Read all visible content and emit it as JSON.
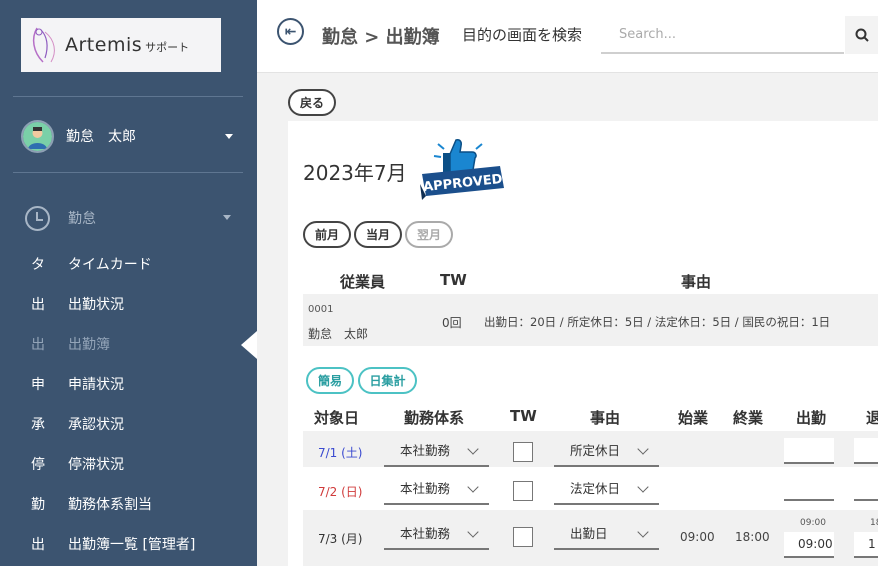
{
  "logo": {
    "name": "Artemis",
    "sub": "サポート"
  },
  "user": {
    "name": "勤怠　太郎"
  },
  "sidebar": {
    "section": "勤怠",
    "items": [
      {
        "abbr": "タ",
        "label": "タイムカード"
      },
      {
        "abbr": "出",
        "label": "出勤状況"
      },
      {
        "abbr": "出",
        "label": "出勤簿"
      },
      {
        "abbr": "申",
        "label": "申請状況"
      },
      {
        "abbr": "承",
        "label": "承認状況"
      },
      {
        "abbr": "停",
        "label": "停滞状況"
      },
      {
        "abbr": "勤",
        "label": "勤務体系割当"
      },
      {
        "abbr": "出",
        "label": "出勤簿一覧 [管理者]"
      }
    ]
  },
  "header": {
    "breadcrumb": "勤怠 > 出勤簿",
    "search_label": "目的の画面を検索",
    "search_placeholder": "Search..."
  },
  "back_button": "戻る",
  "card": {
    "month": "2023年7月",
    "badge_text": "APPROVED",
    "month_nav": {
      "prev": "前月",
      "current": "当月",
      "next": "翌月"
    },
    "summary": {
      "headers": {
        "employee": "従業員",
        "tw": "TW",
        "reason": "事由"
      },
      "row": {
        "id": "0001",
        "name": "勤怠　太郎",
        "tw": "0回",
        "reason": "出勤日：20日 / 所定休日：5日 / 法定休日：5日 / 国民の祝日：1日"
      }
    },
    "view_buttons": {
      "simple": "簡易",
      "daily": "日集計"
    },
    "table": {
      "headers": {
        "date": "対象日",
        "schedule": "勤務体系",
        "tw": "TW",
        "reason": "事由",
        "start": "始業",
        "end": "終業",
        "in": "出勤",
        "out": "退"
      },
      "rows": [
        {
          "date": "7/1 (土)",
          "date_color": "#3b4bd0",
          "schedule": "本社勤務",
          "reason": "所定休日",
          "start": "",
          "end": "",
          "in_hint": "",
          "in_value": "",
          "out_hint": "",
          "out_value": ""
        },
        {
          "date": "7/2 (日)",
          "date_color": "#d03b3b",
          "schedule": "本社勤務",
          "reason": "法定休日",
          "start": "",
          "end": "",
          "in_hint": "",
          "in_value": "",
          "out_hint": "",
          "out_value": ""
        },
        {
          "date": "7/3 (月)",
          "date_color": "#333333",
          "schedule": "本社勤務",
          "reason": "出勤日",
          "start": "09:00",
          "end": "18:00",
          "in_hint": "09:00",
          "in_value": "09:00",
          "out_hint": "18",
          "out_value": "1"
        }
      ]
    }
  }
}
